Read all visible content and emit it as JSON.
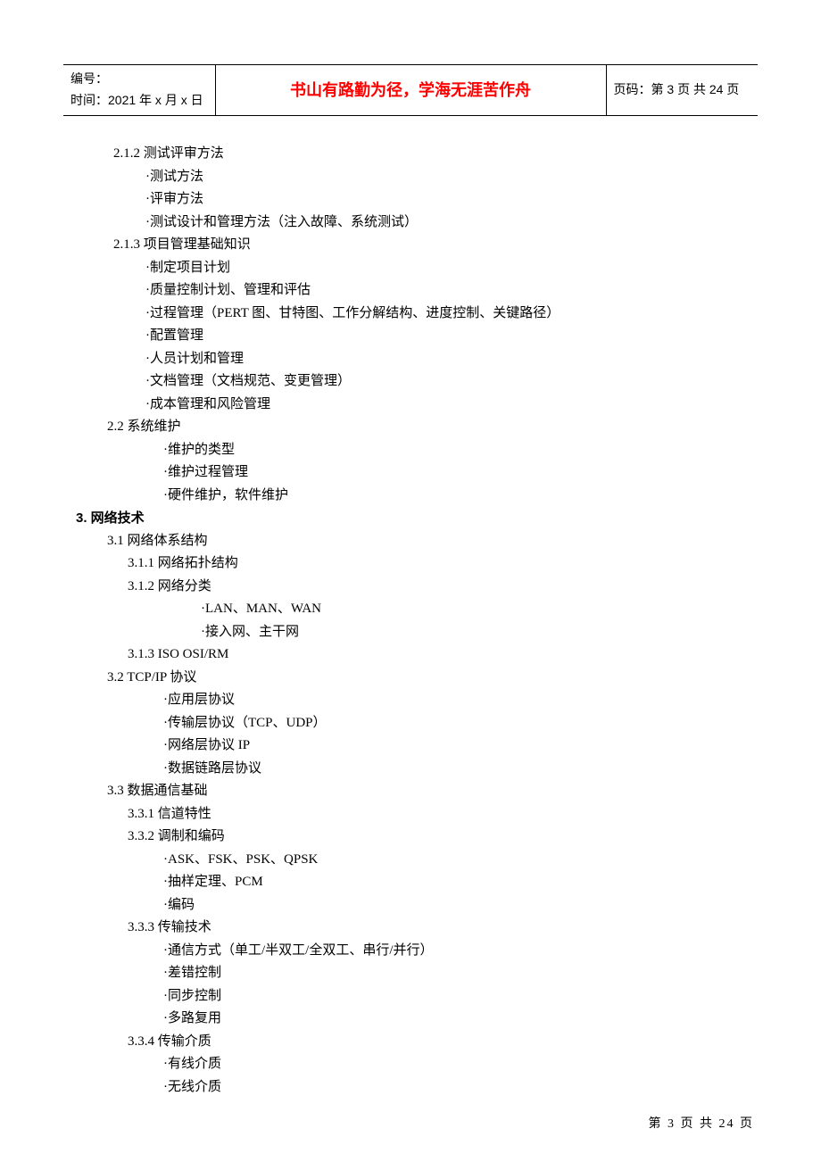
{
  "header": {
    "left_line1": "编号：",
    "left_line2": "时间：2021 年 x 月 x 日",
    "center": "书山有路勤为径，学海无涯苦作舟",
    "right": "页码：第 3 页 共 24 页"
  },
  "content": {
    "s212": "2.1.2 测试评审方法",
    "s212_b1": "·测试方法",
    "s212_b2": "·评审方法",
    "s212_b3": "·测试设计和管理方法（注入故障、系统测试）",
    "s213": "2.1.3 项目管理基础知识",
    "s213_b1": "·制定项目计划",
    "s213_b2": "·质量控制计划、管理和评估",
    "s213_b3": "·过程管理（PERT 图、甘特图、工作分解结构、进度控制、关键路径）",
    "s213_b4": "·配置管理",
    "s213_b5": "·人员计划和管理",
    "s213_b6": "·文档管理（文档规范、变更管理）",
    "s213_b7": "·成本管理和风险管理",
    "s22": "2.2 系统维护",
    "s22_b1": "·维护的类型",
    "s22_b2": "·维护过程管理",
    "s22_b3": "·硬件维护，软件维护",
    "s3": "3. 网络技术",
    "s31": "3.1 网络体系结构",
    "s311": "3.1.1 网络拓扑结构",
    "s312": "3.1.2 网络分类",
    "s312_b1": "·LAN、MAN、WAN",
    "s312_b2": "·接入网、主干网",
    "s313": "3.1.3 ISO OSI/RM",
    "s32": "3.2 TCP/IP 协议",
    "s32_b1": "·应用层协议",
    "s32_b2": "·传输层协议（TCP、UDP）",
    "s32_b3": "·网络层协议 IP",
    "s32_b4": "·数据链路层协议",
    "s33": "3.3 数据通信基础",
    "s331": "3.3.1 信道特性",
    "s332": "3.3.2 调制和编码",
    "s332_b1": "·ASK、FSK、PSK、QPSK",
    "s332_b2": "·抽样定理、PCM",
    "s332_b3": "·编码",
    "s333": "3.3.3 传输技术",
    "s333_b1": "·通信方式（单工/半双工/全双工、串行/并行）",
    "s333_b2": "·差错控制",
    "s333_b3": "·同步控制",
    "s333_b4": "·多路复用",
    "s334": "3.3.4 传输介质",
    "s334_b1": "·有线介质",
    "s334_b2": "·无线介质"
  },
  "footer": "第 3 页 共 24 页"
}
